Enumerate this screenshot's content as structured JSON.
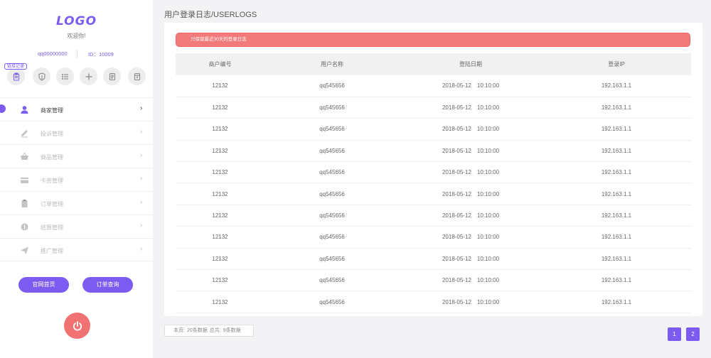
{
  "sidebar": {
    "logo": "LOGO",
    "welcome": "欢迎你!",
    "account": "qq00000000",
    "user_id": "ID：10009",
    "quick_tag": "链接记录",
    "quick_icons": [
      "clipboard-icon",
      "shield-icon",
      "list-icon",
      "plus-icon",
      "document-icon",
      "receipt-icon"
    ],
    "menu": [
      {
        "label": "商家管理",
        "icon": "user-icon",
        "active": true
      },
      {
        "label": "投诉管理",
        "icon": "pencil-icon",
        "active": false
      },
      {
        "label": "商品管理",
        "icon": "basket-icon",
        "active": false
      },
      {
        "label": "卡密管理",
        "icon": "card-icon",
        "active": false
      },
      {
        "label": "订单管理",
        "icon": "clipboard-icon",
        "active": false
      },
      {
        "label": "结算管理",
        "icon": "coin-icon",
        "active": false
      },
      {
        "label": "推广管理",
        "icon": "paper-plane-icon",
        "active": false
      }
    ],
    "home_button": "官网首页",
    "order_button": "订单查询"
  },
  "page": {
    "title": "用户登录日志/USERLOGS",
    "alert": "只保留最近30天的登录日志"
  },
  "table": {
    "headers": [
      "商户编号",
      "用户名称",
      "登陆日期",
      "登录IP"
    ],
    "rows": [
      [
        "12132",
        "qq545656",
        "2018-05-12",
        "10:10:00",
        "192.163.1.1"
      ],
      [
        "12132",
        "qq545656",
        "2018-05-12",
        "10:10:00",
        "192.163.1.1"
      ],
      [
        "12132",
        "qq545656",
        "2018-05-12",
        "10:10:00",
        "192.163.1.1"
      ],
      [
        "12132",
        "qq545656",
        "2018-05-12",
        "10:10:00",
        "192.163.1.1"
      ],
      [
        "12132",
        "qq545656",
        "2018-05-12",
        "10:10:00",
        "192.163.1.1"
      ],
      [
        "12132",
        "qq545656",
        "2018-05-12",
        "10:10:00",
        "192.163.1.1"
      ],
      [
        "12132",
        "qq545656",
        "2018-05-12",
        "10:10:00",
        "192.163.1.1"
      ],
      [
        "12132",
        "qq545656",
        "2018-05-12",
        "10:10:00",
        "192.163.1.1"
      ],
      [
        "12132",
        "qq545656",
        "2018-05-12",
        "10:10:00",
        "192.163.1.1"
      ],
      [
        "12132",
        "qq545656",
        "2018-05-12",
        "10:10:00",
        "192.163.1.1"
      ],
      [
        "12132",
        "qq545656",
        "2018-05-12",
        "10:10:00",
        "192.163.1.1"
      ]
    ]
  },
  "footer": {
    "page_label": "本页:",
    "page_count": "20条数据",
    "total_label": "总共:",
    "total_count": "9条数据",
    "pages": [
      "1",
      "2"
    ]
  },
  "colors": {
    "accent": "#7c5cf0",
    "alert": "#f17a7a",
    "power": "#f17272",
    "background": "#f3f3f5"
  }
}
